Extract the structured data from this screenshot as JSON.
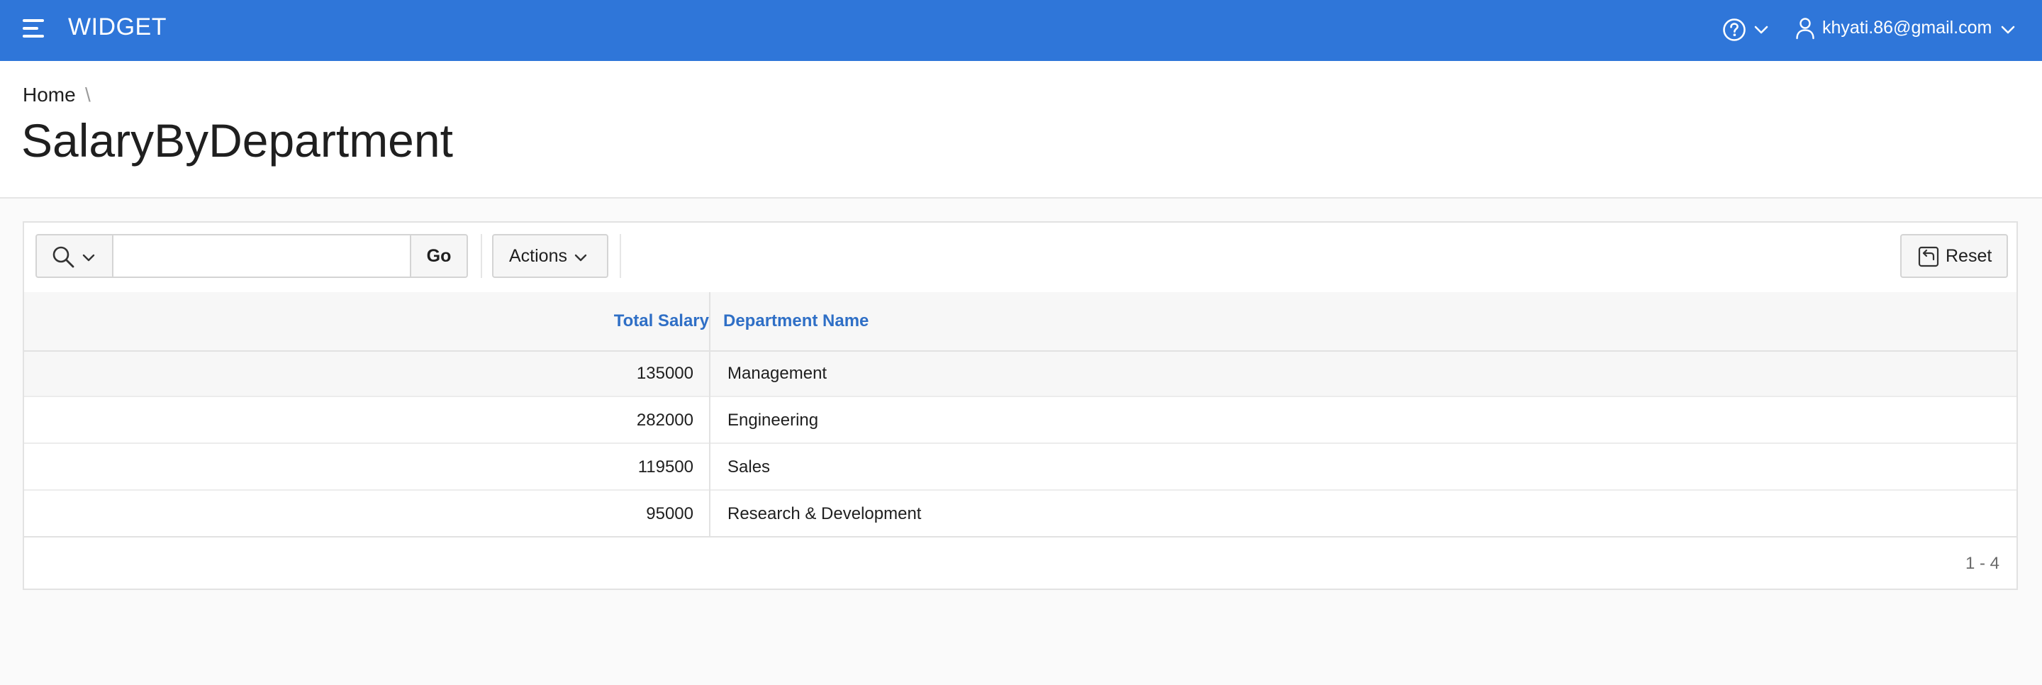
{
  "header": {
    "app_title": "WIDGET",
    "menu_icon": "hamburger-menu-icon",
    "help_icon": "help-circle-icon",
    "user_icon": "user-icon",
    "user_email": "khyati.86@gmail.com",
    "brand_color": "#2f76d9"
  },
  "breadcrumb": {
    "items": [
      {
        "label": "Home"
      }
    ],
    "separator": "\\"
  },
  "page": {
    "title": "SalaryByDepartment"
  },
  "toolbar": {
    "search_column_icon": "search-icon",
    "search_value": "",
    "search_placeholder": "",
    "go_label": "Go",
    "actions_label": "Actions",
    "reset_label": "Reset",
    "reset_icon": "reset-icon"
  },
  "report": {
    "columns": [
      {
        "key": "total_salary",
        "label": "Total Salary"
      },
      {
        "key": "department_name",
        "label": "Department Name"
      }
    ],
    "rows": [
      {
        "total_salary": "135000",
        "department_name": "Management"
      },
      {
        "total_salary": "282000",
        "department_name": "Engineering"
      },
      {
        "total_salary": "119500",
        "department_name": "Sales"
      },
      {
        "total_salary": "95000",
        "department_name": "Research & Development"
      }
    ],
    "highlighted_row": 0,
    "pagination": "1 - 4",
    "link_color": "#2f6fc6"
  }
}
